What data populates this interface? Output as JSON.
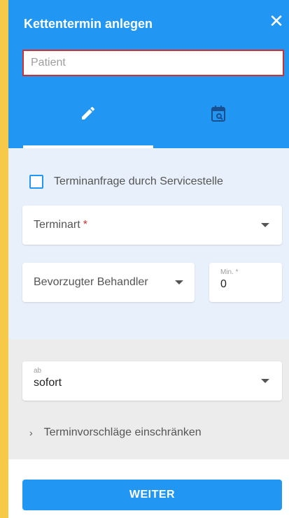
{
  "dialog": {
    "title": "Kettentermin anlegen",
    "close_label": "✕"
  },
  "patient": {
    "placeholder": "Patient",
    "value": ""
  },
  "tabs": [
    {
      "name": "edit",
      "icon": "pencil-icon",
      "active": true
    },
    {
      "name": "calendar-search",
      "icon": "calendar-search-icon",
      "active": false
    }
  ],
  "checkbox": {
    "label": "Terminanfrage durch Servicestelle",
    "checked": false
  },
  "terminart": {
    "label": "Terminart",
    "required_mark": "*"
  },
  "behandler": {
    "label": "Bevorzugter Behandler"
  },
  "minutes": {
    "label": "Min. *",
    "value": "0"
  },
  "start": {
    "label": "ab",
    "value": "sofort"
  },
  "expander": {
    "chevron": "›",
    "label": "Terminvorschläge einschränken"
  },
  "footer": {
    "button_label": "WEITER"
  },
  "colors": {
    "primary": "#2196f3",
    "error": "#d32f2f",
    "accent_border": "#f7c948"
  }
}
